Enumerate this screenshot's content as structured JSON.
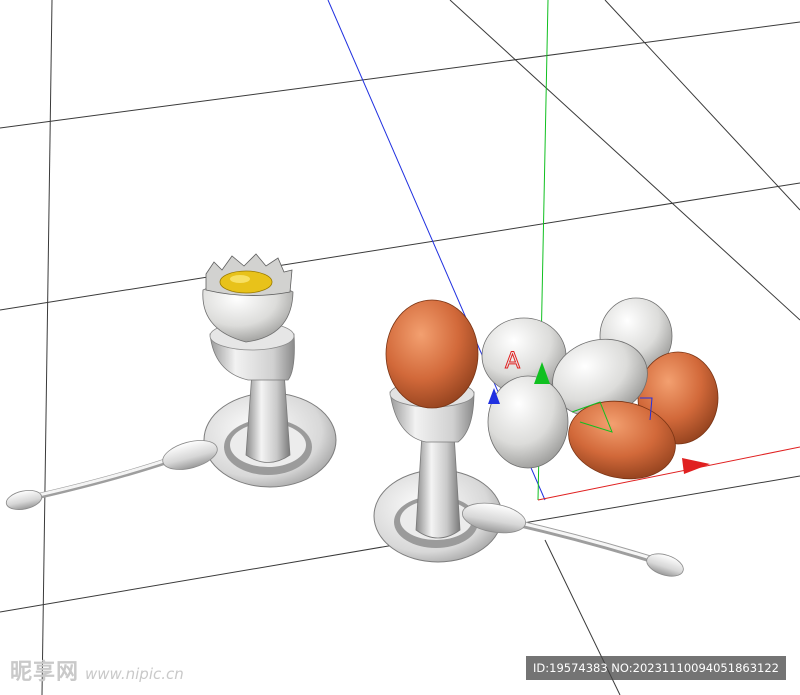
{
  "viewport": {
    "background": "#ffffff",
    "grid_color": "#3a3a3a",
    "axis_colors": {
      "x": "#e02020",
      "y": "#10c020",
      "z": "#2030e0"
    }
  },
  "scene": {
    "objects": [
      "opened-soft-boiled-egg-in-cup",
      "whole-brown-egg-in-cup",
      "egg-pile",
      "spoon-left",
      "spoon-right"
    ],
    "egg_colors": {
      "brown": "#d2693a",
      "white": "#e2e2e0",
      "yolk": "#e8c21a"
    },
    "pivot_label": "A"
  },
  "watermark": {
    "logo": "昵享网",
    "url": "www.nipic.cn"
  },
  "id_badge": "ID:19574383 NO:20231110094051863122"
}
